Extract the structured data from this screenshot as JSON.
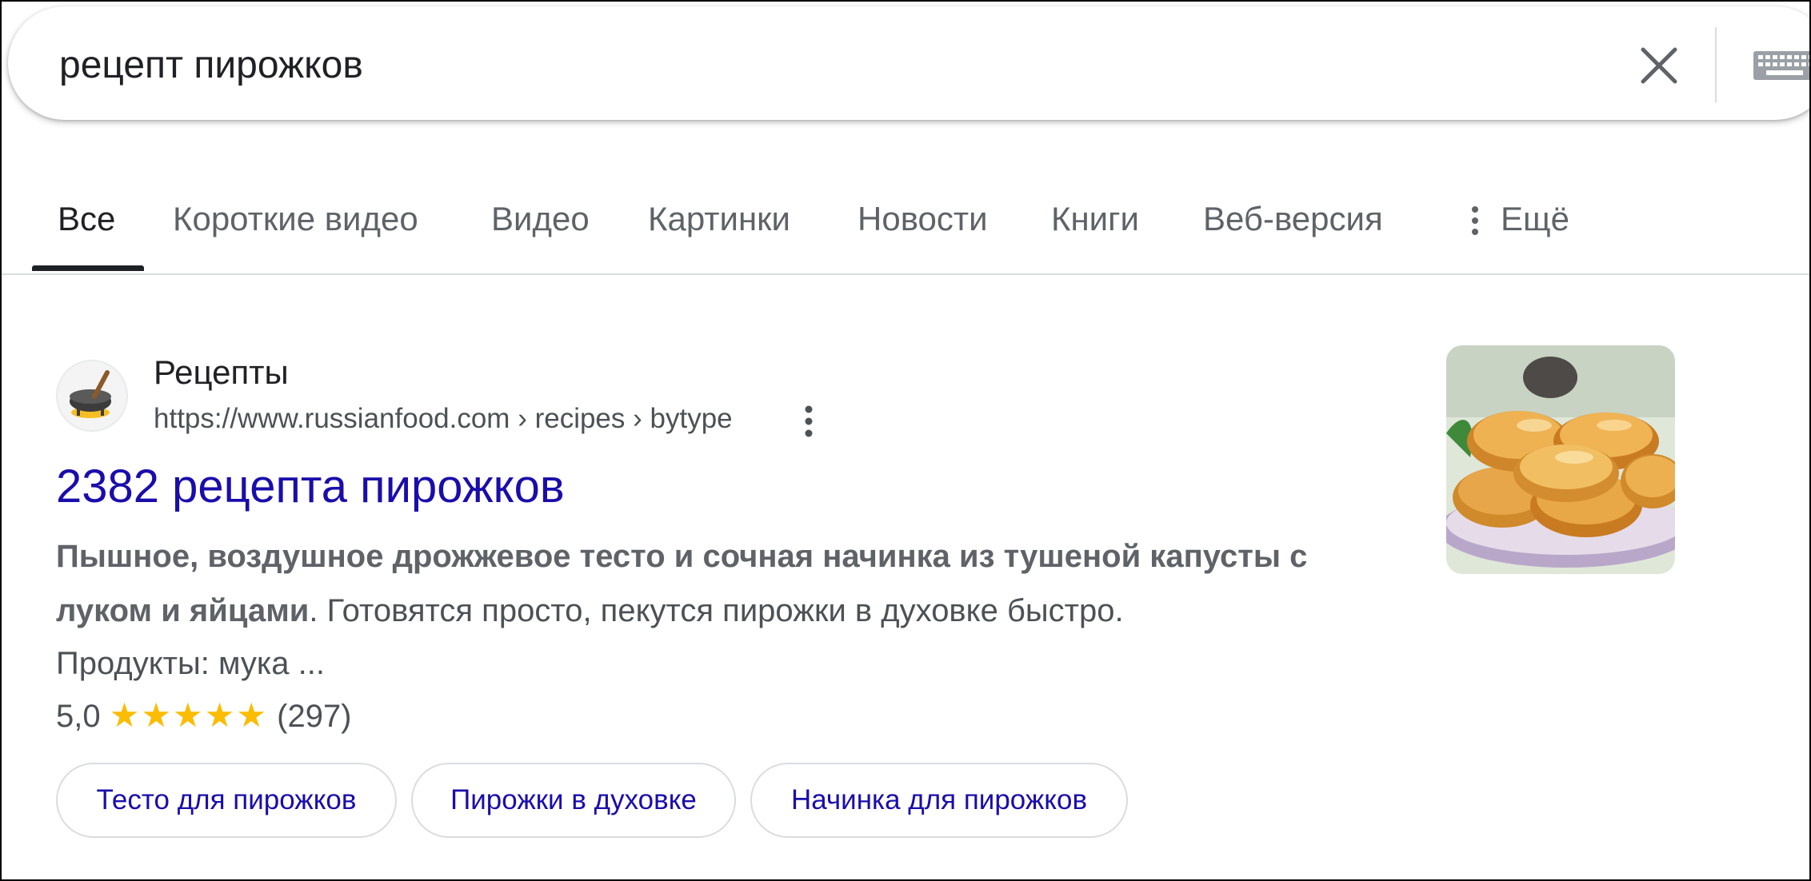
{
  "search": {
    "query": "рецепт пирожков"
  },
  "tabs": [
    {
      "label": "Все",
      "active": true
    },
    {
      "label": "Короткие видео"
    },
    {
      "label": "Видео"
    },
    {
      "label": "Картинки"
    },
    {
      "label": "Новости"
    },
    {
      "label": "Книги"
    },
    {
      "label": "Веб-версия"
    },
    {
      "label": "Ещё"
    }
  ],
  "result": {
    "site_name": "Рецепты",
    "url": "https://www.russianfood.com › recipes › bytype",
    "title": "2382 рецепта пирожков",
    "snippet_bold_1": "Пышное, воздушное дрожжевое тесто и сочная начинка из тушеной капусты",
    "snippet_bold_2": "с луком и яйцами",
    "snippet_rest": ". Готовятся просто, пекутся пирожки в духовке быстро.",
    "snippet_line2": "Продукты: мука ...",
    "rating": "5,0",
    "rating_value": 5,
    "stars": "★★★★★",
    "reviews": "(297)"
  },
  "chips": [
    {
      "label": "Тесто для пирожков"
    },
    {
      "label": "Пирожки в духовке"
    },
    {
      "label": "Начинка для пирожков"
    }
  ],
  "colors": {
    "link": "#1a0dab",
    "star": "#fbbc04",
    "text_secondary": "#4d5156",
    "tab_inactive": "#5f6368"
  },
  "icons": {
    "clear": "close-icon",
    "keyboard": "keyboard-icon",
    "more": "vertical-dots-icon",
    "favicon": "cooking-pot-icon"
  }
}
